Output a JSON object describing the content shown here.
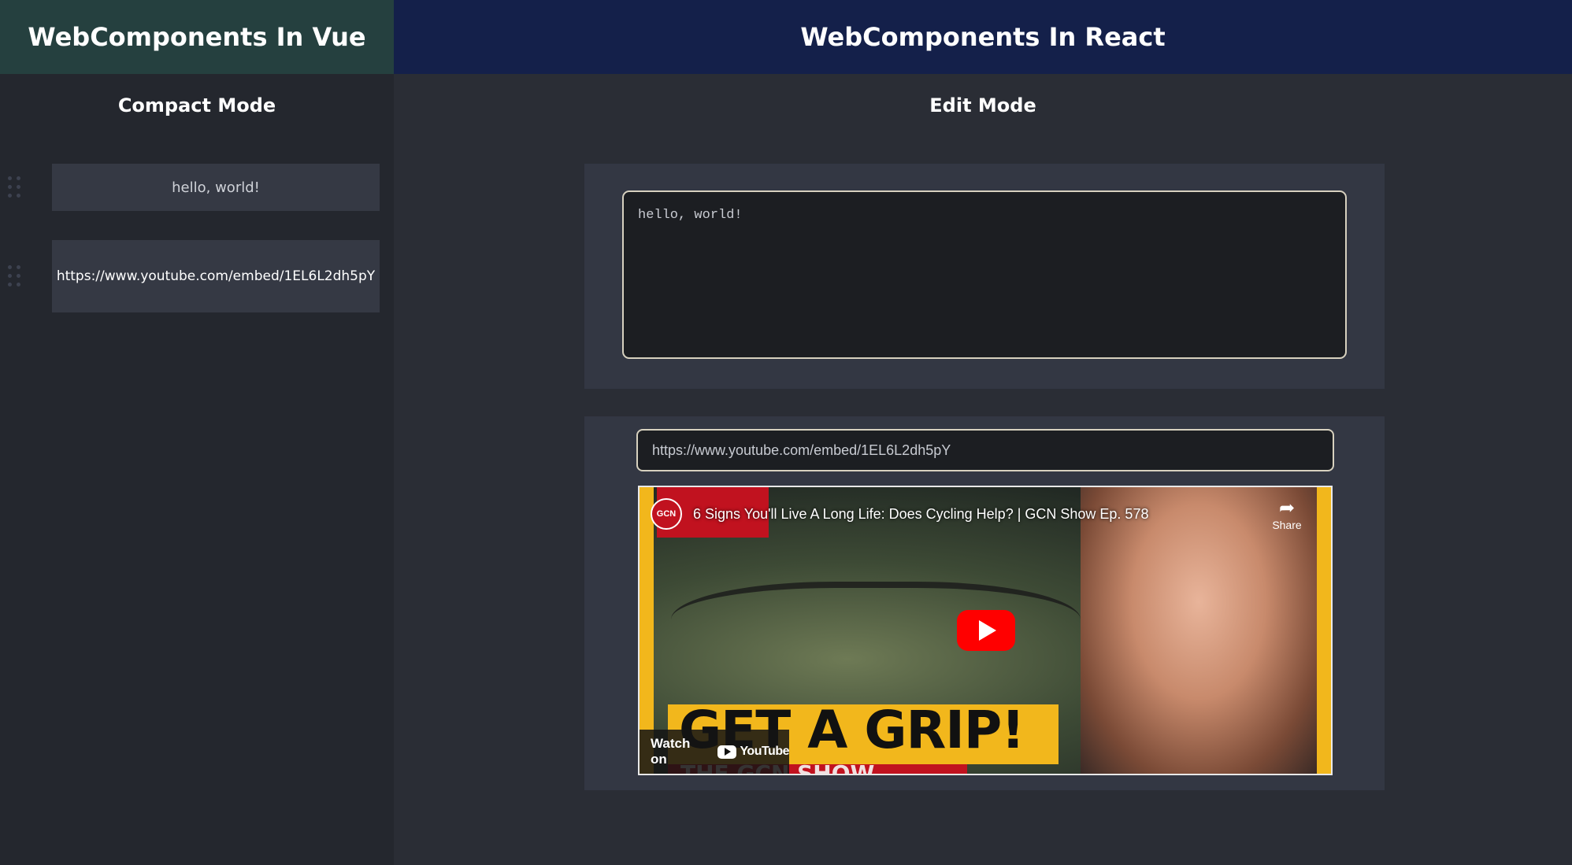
{
  "vue": {
    "header_title": "WebComponents In Vue",
    "mode_title": "Compact Mode",
    "items": [
      {
        "text": "hello, world!"
      },
      {
        "text": "https://www.youtube.com/embed/1EL6L2dh5pY"
      }
    ]
  },
  "react": {
    "header_title": "WebComponents In React",
    "mode_title": "Edit Mode",
    "text_block": {
      "value": "hello, world!"
    },
    "video_block": {
      "url_value": "https://www.youtube.com/embed/1EL6L2dh5pY",
      "video": {
        "channel_logo": "GCN",
        "title": "6 Signs You'll Live A Long Life: Does Cycling Help? | GCN Show Ep. 578",
        "share_label": "Share",
        "thumbnail_text": "GET A GRIP!",
        "thumbnail_subtext": "THE GCN SHOW",
        "watch_on": "Watch on",
        "youtube_label": "YouTube"
      }
    }
  },
  "colors": {
    "vue_header": "#25403f",
    "react_header": "#14204a",
    "play_button": "#ff0000"
  }
}
